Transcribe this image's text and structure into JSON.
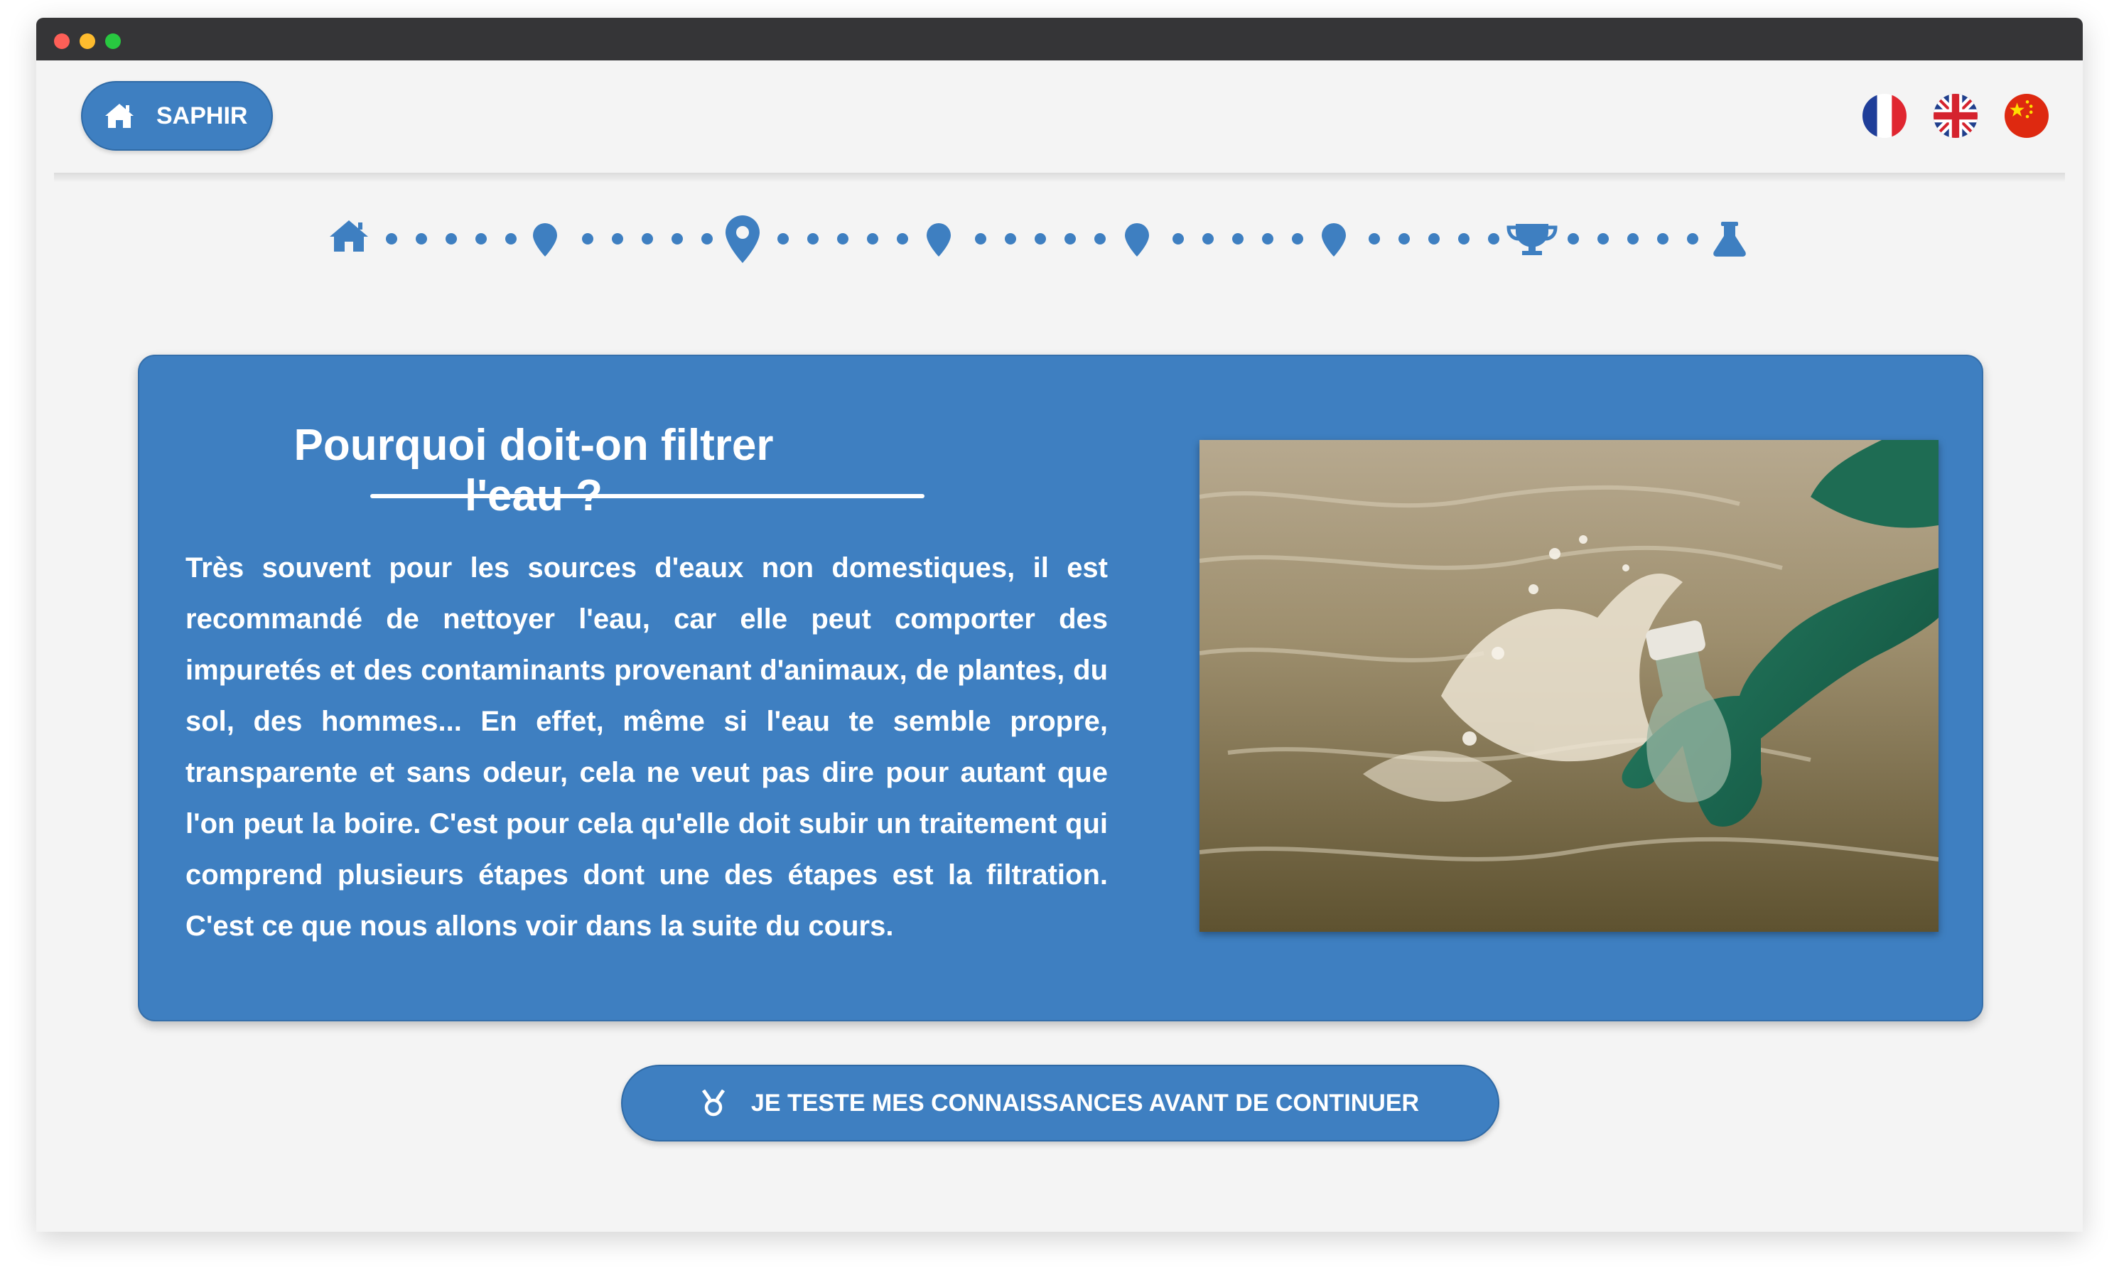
{
  "header": {
    "home_label": "SAPHIR",
    "languages": [
      "fr",
      "en",
      "zh"
    ]
  },
  "progress": {
    "steps": [
      "home-icon",
      "map-marker-icon",
      "map-marker-icon-current",
      "map-marker-icon",
      "map-marker-icon",
      "map-marker-icon",
      "trophy-icon",
      "flask-icon"
    ],
    "current_step": 2
  },
  "card": {
    "title": "Pourquoi doit-on filtrer l'eau ?",
    "body": "Très souvent pour les sources d'eaux non domestiques, il est recommandé de nettoyer l'eau, car elle peut comporter des impuretés et des contaminants provenant d'animaux, de plantes, du sol, des hommes... En effet, même si l'eau te semble propre, transparente et sans odeur, cela ne veut pas dire pour autant que l'on peut la boire. C'est pour cela qu'elle doit subir un traitement qui comprend plusieurs étapes dont une des étapes est la filtration. C'est ce que nous allons voir dans la suite du cours.",
    "image": "gloved-hand-sampling-water-photo"
  },
  "quiz_button": {
    "label": "JE TESTE MES CONNAISSANCES AVANT DE CONTINUER",
    "icon": "medal-icon"
  },
  "colors": {
    "accent": "#3e7fc1",
    "background": "#f4f4f4",
    "titlebar": "#353537"
  }
}
